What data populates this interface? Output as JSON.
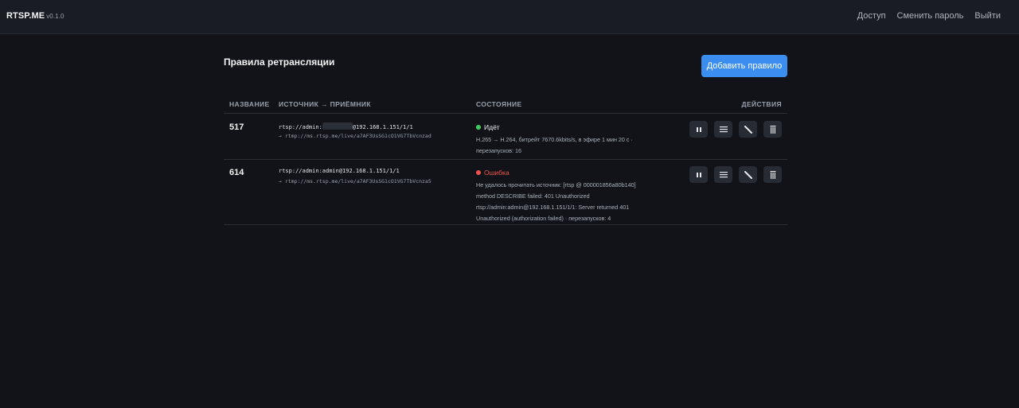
{
  "header": {
    "brand": "RTSP.ME",
    "version": "v0.1.0",
    "nav": [
      "Доступ",
      "Сменить пароль",
      "Выйти"
    ]
  },
  "page": {
    "title": "Правила ретрансляции",
    "add_button": "Добавить правило"
  },
  "table": {
    "columns": [
      "НАЗВАНИЕ",
      "ИСТОЧНИК → ПРИЁМНИК",
      "СОСТОЯНИЕ",
      "ДЕЙСТВИЯ"
    ],
    "rows": [
      {
        "name": "517",
        "source_prefix": "rtsp://admin:",
        "source_suffix": "@192.168.1.151/1/1",
        "destination": "→ rtmp://ms.rtsp.me/live/a7AF3UsSG1cO1VG7TbVcnzad",
        "status": "Идёт",
        "status_color": "#3ecf5a",
        "details": [
          "H.265 → H.264, битрейт 7670.6kbits/s, в эфире 1 мин 20 с ·",
          "перезапусков: 16"
        ],
        "actions": [
          "pause-icon",
          "menu-icon",
          "edit-icon",
          "delete-icon"
        ]
      },
      {
        "name": "614",
        "source": "rtsp://admin:admin@192.168.1.151/1/1",
        "destination": "→ rtmp://ms.rtsp.me/live/a7AF3UsSG1cO1VG7TbVcnza5",
        "status": "Ошибка",
        "status_color": "#f0524b",
        "details": [
          "Не удалось прочитать источник: [rtsp @ 000001856a80b140]",
          "method DESCRIBE failed: 401 Unauthorized",
          "rtsp://admin:admin@192.168.1.151/1/1: Server returned 401",
          "Unauthorized (authorization failed) · перезапусков: 4"
        ],
        "actions": [
          "pause-icon",
          "menu-icon",
          "edit-icon",
          "delete-icon"
        ]
      }
    ]
  },
  "colors": {
    "background": "#111318",
    "header_bg": "#191c23",
    "accent": "#3b8ef0",
    "running": "#3ecf5a",
    "error": "#f0524b"
  }
}
